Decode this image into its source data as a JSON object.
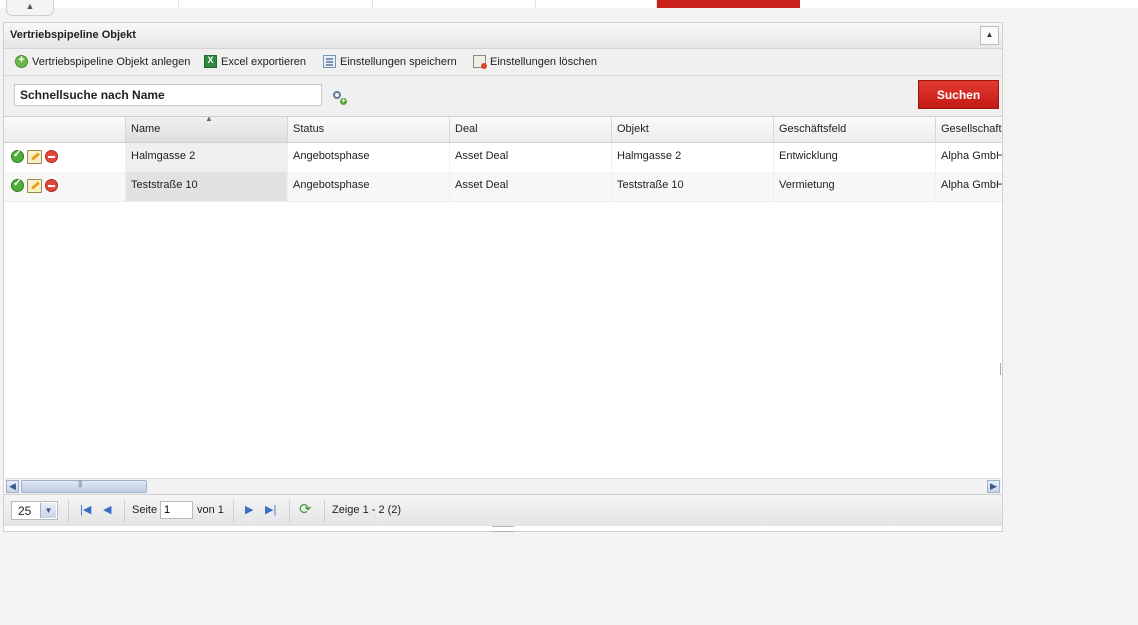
{
  "top_tab": {
    "label": "▲"
  },
  "panel": {
    "title": "Vertriebspipeline Objekt",
    "collapse_label": "▲"
  },
  "toolbar": {
    "create_label": "Vertriebspipeline Objekt anlegen",
    "excel_label": "Excel exportieren",
    "save_settings_label": "Einstellungen speichern",
    "delete_settings_label": "Einstellungen löschen"
  },
  "search": {
    "value": "Schnellsuche nach Name",
    "button_label": "Suchen"
  },
  "grid": {
    "columns": [
      "Name",
      "Status",
      "Deal",
      "Objekt",
      "Geschäftsfeld",
      "Gesellschaft"
    ],
    "sorted_column": "Name",
    "rows": [
      {
        "name": "Halmgasse 2",
        "status": "Angebotsphase",
        "deal": "Asset Deal",
        "objekt": "Halmgasse 2",
        "geschaeftsfeld": "Entwicklung",
        "gesellschaft": "Alpha GmbH"
      },
      {
        "name": "Teststraße 10",
        "status": "Angebotsphase",
        "deal": "Asset Deal",
        "objekt": "Teststraße 10",
        "geschaeftsfeld": "Vermietung",
        "gesellschaft": "Alpha GmbH"
      }
    ]
  },
  "pager": {
    "page_size": "25",
    "page_label": "Seite",
    "current_page": "1",
    "of_label": "von 1",
    "display_info": "Zeige 1 - 2 (2)"
  },
  "colors": {
    "accent_red": "#c8201a",
    "search_button": "#d52a22"
  }
}
